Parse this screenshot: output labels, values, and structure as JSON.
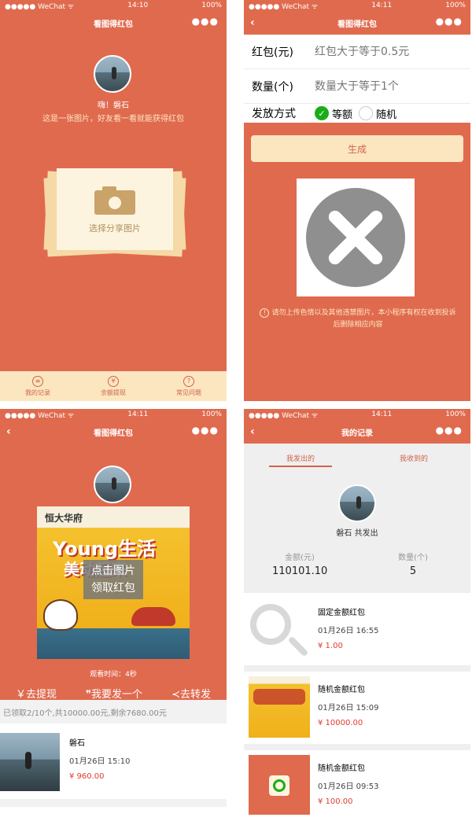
{
  "p1": {
    "status": {
      "carrier": "●●●●● WeChat ᯤ",
      "time": "14:10",
      "battery": "100%"
    },
    "title": "看图得红包",
    "greeting": "嗨！磐石",
    "hint": "这是一张图片，好友看一看就能获得红包",
    "card_label": "选择分享图片",
    "tabs": [
      {
        "icon": "≡",
        "label": "我的记录"
      },
      {
        "icon": "¥",
        "label": "余额提现"
      },
      {
        "icon": "?",
        "label": "常见问题"
      }
    ]
  },
  "p2": {
    "status": {
      "carrier": "●●●●● WeChat ᯤ",
      "time": "14:11",
      "battery": "100%"
    },
    "title": "看图得红包",
    "amount_label": "红包(元)",
    "amount_placeholder": "红包大于等于0.5元",
    "count_label": "数量(个)",
    "count_placeholder": "数量大于等于1个",
    "method_label": "发放方式",
    "method_equal": "等额",
    "method_random": "随机",
    "generate": "生成",
    "warning": "请勿上传色情以及其他违禁图片，本小程序有权在收到投诉后删除相应内容"
  },
  "p3": {
    "status": {
      "carrier": "●●●●● WeChat ᯤ",
      "time": "14:11",
      "battery": "100%"
    },
    "title": "看图得红包",
    "poster_brand": "恒大华府",
    "poster_big": "Young生活",
    "poster_sub": "美动起来",
    "overlay_line1": "点击图片",
    "overlay_line2": "领取红包",
    "watch_time": "观看时间：4秒",
    "actions": [
      "￥去提现",
      "❞我要发一个",
      "≺去转发"
    ],
    "summary": "已领取2/10个,共10000.00元,剩余7680.00元",
    "record": {
      "name": "磐石",
      "time": "01月26日 15:10",
      "amount": "¥ 960.00"
    }
  },
  "p4": {
    "status": {
      "carrier": "●●●●● WeChat ᯤ",
      "time": "14:11",
      "battery": "100%"
    },
    "title": "我的记录",
    "tab_sent": "我发出的",
    "tab_received": "我收到的",
    "user_line": "磐石 共发出",
    "amount_label": "金额(元)",
    "amount_value": "110101.10",
    "count_label": "数量(个)",
    "count_value": "5",
    "records": [
      {
        "title": "固定金额红包",
        "time": "01月26日 16:55",
        "amount": "¥ 1.00"
      },
      {
        "title": "随机金额红包",
        "time": "01月26日 15:09",
        "amount": "¥ 10000.00"
      },
      {
        "title": "随机金额红包",
        "time": "01月26日 09:53",
        "amount": "¥ 100.00"
      }
    ]
  },
  "colors": {
    "primary": "#e06a4e",
    "cream": "#fbe6c0",
    "green": "#1aad19",
    "price": "#e03b2d"
  }
}
